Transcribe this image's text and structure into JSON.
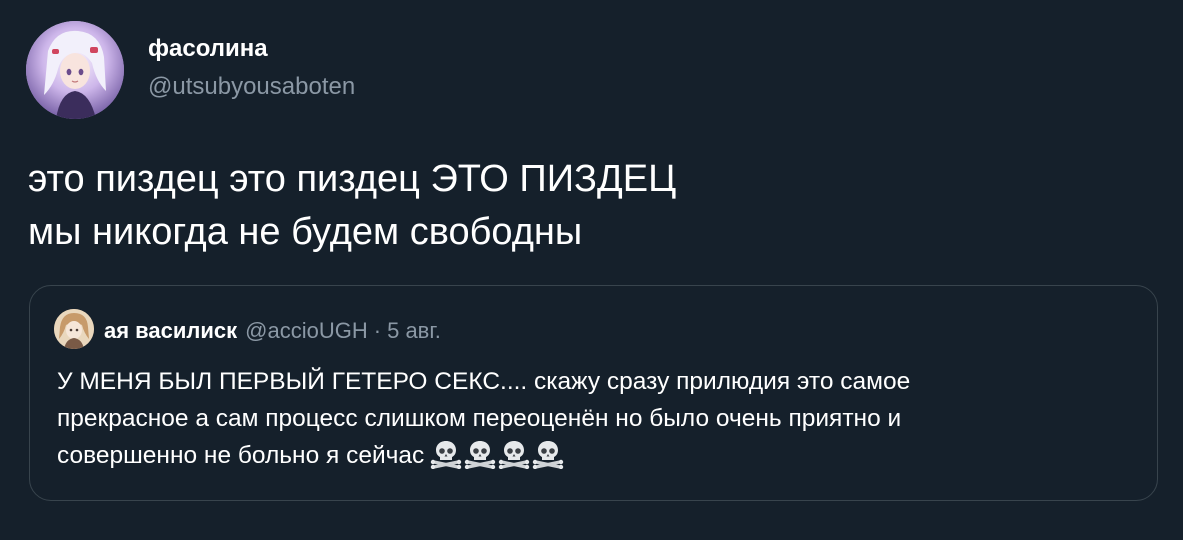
{
  "tweet": {
    "author": {
      "name": "фасолина",
      "handle": "@utsubyousaboten"
    },
    "text_lines": [
      "это пиздец это пиздец ЭТО ПИЗДЕЦ",
      "мы никогда не будем свободны"
    ]
  },
  "quote": {
    "author_name": "ая василиск",
    "handle": "@accioUGH",
    "separator": "·",
    "date": "5 авг.",
    "text_lines": [
      "У МЕНЯ БЫЛ ПЕРВЫЙ ГЕТЕРО СЕКС.... скажу сразу прилюдия это самое",
      "прекрасное а сам процесс слишком переоценён но было очень приятно и",
      "совершенно не больно я сейчас"
    ],
    "emojis": [
      "skull-crossbones-icon",
      "skull-crossbones-icon",
      "skull-crossbones-icon",
      "skull-crossbones-icon"
    ]
  },
  "colors": {
    "background": "#15202b",
    "primary_text": "#ffffff",
    "secondary_text": "#8b98a5",
    "border": "#38444d"
  }
}
